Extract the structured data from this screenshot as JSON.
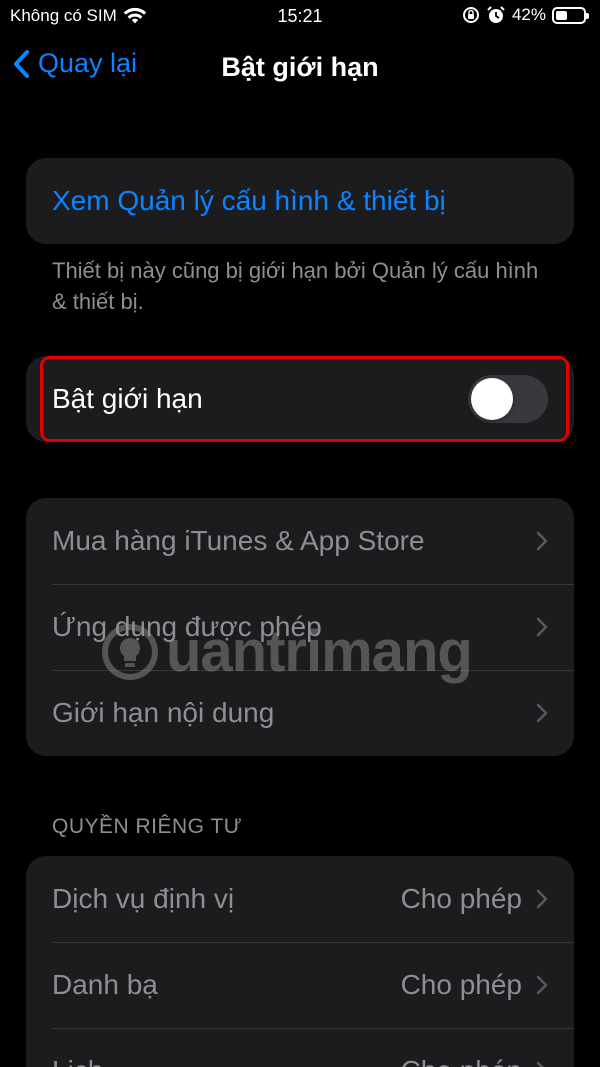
{
  "status_bar": {
    "carrier": "Không có SIM",
    "time": "15:21",
    "battery_percent": "42%",
    "battery_level": 0.42,
    "icons": [
      "wifi-icon",
      "rotation-lock-icon",
      "alarm-icon",
      "battery-icon"
    ]
  },
  "nav": {
    "back_label": "Quay lại",
    "title": "Bật giới hạn"
  },
  "profile_group": {
    "link_label": "Xem Quản lý cấu hình & thiết bị",
    "footer": "Thiết bị này cũng bị giới hạn bởi Quản lý cấu hình & thiết bị."
  },
  "restrictions_toggle": {
    "label": "Bật giới hạn",
    "enabled": false
  },
  "store_group": {
    "items": [
      {
        "label": "Mua hàng iTunes & App Store"
      },
      {
        "label": "Ứng dụng được phép"
      },
      {
        "label": "Giới hạn nội dung"
      }
    ]
  },
  "privacy_section": {
    "header": "QUYỀN RIÊNG TƯ",
    "items": [
      {
        "label": "Dịch vụ định vị",
        "value": "Cho phép"
      },
      {
        "label": "Danh bạ",
        "value": "Cho phép"
      },
      {
        "label": "Lịch",
        "value": "Cho phép"
      }
    ]
  },
  "watermark": {
    "text": "uantrimang"
  },
  "colors": {
    "accent": "#0a84ff",
    "background": "#000000",
    "cell": "#1c1c1e",
    "secondary_text": "#8e8e93",
    "highlight": "#e00000"
  }
}
